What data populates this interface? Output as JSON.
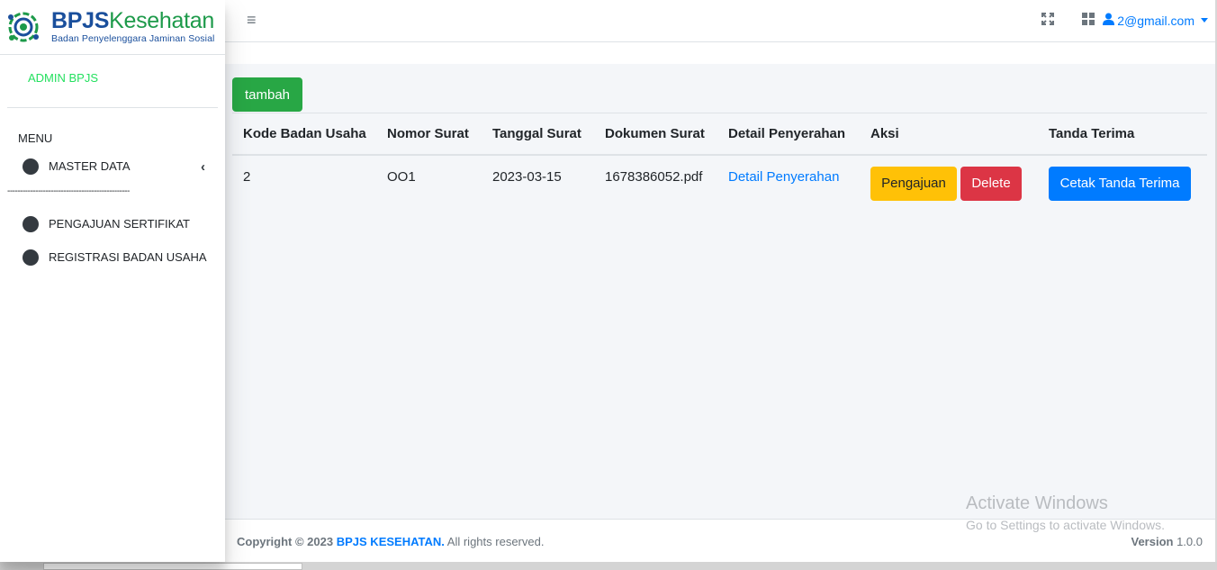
{
  "brand": {
    "name_part1": "BPJS",
    "name_part2": "Kesehatan",
    "subtitle": "Badan Penyelenggara Jaminan Sosial"
  },
  "sidebar": {
    "user": "ADMIN BPJS",
    "menu_header": "MENU",
    "items": [
      {
        "label": "MASTER DATA"
      },
      {
        "label": "PENGAJUAN SERTIFIKAT"
      },
      {
        "label": "REGISTRASI BADAN USAHA"
      }
    ],
    "separator": "------------------------------------------------"
  },
  "topbar": {
    "user_email": "2@gmail.com"
  },
  "actions": {
    "add_label": "tambah"
  },
  "table": {
    "headers": [
      "Kode Badan Usaha",
      "Nomor Surat",
      "Tanggal Surat",
      "Dokumen Surat",
      "Detail Penyerahan",
      "Aksi",
      "Tanda Terima"
    ],
    "rows": [
      {
        "kode": "2",
        "nomor": "OO1",
        "tanggal": "2023-03-15",
        "dokumen": "1678386052.pdf",
        "detail": "Detail Penyerahan",
        "pengajuan": "Pengajuan",
        "delete": "Delete",
        "tanda_terima": "Cetak Tanda Terima"
      }
    ]
  },
  "footer": {
    "copyright_prefix": "Copyright © 2023",
    "brand": "BPJS KESEHATAN.",
    "suffix": "All rights reserved.",
    "version_label": "Version",
    "version": "1.0.0"
  },
  "watermark": {
    "title": "Activate Windows",
    "subtitle": "Go to Settings to activate Windows."
  },
  "colors": {
    "primary": "#007bff",
    "success": "#28a745",
    "warning": "#ffc107",
    "danger": "#dc3545",
    "sidebar_user": "#24e05f"
  }
}
